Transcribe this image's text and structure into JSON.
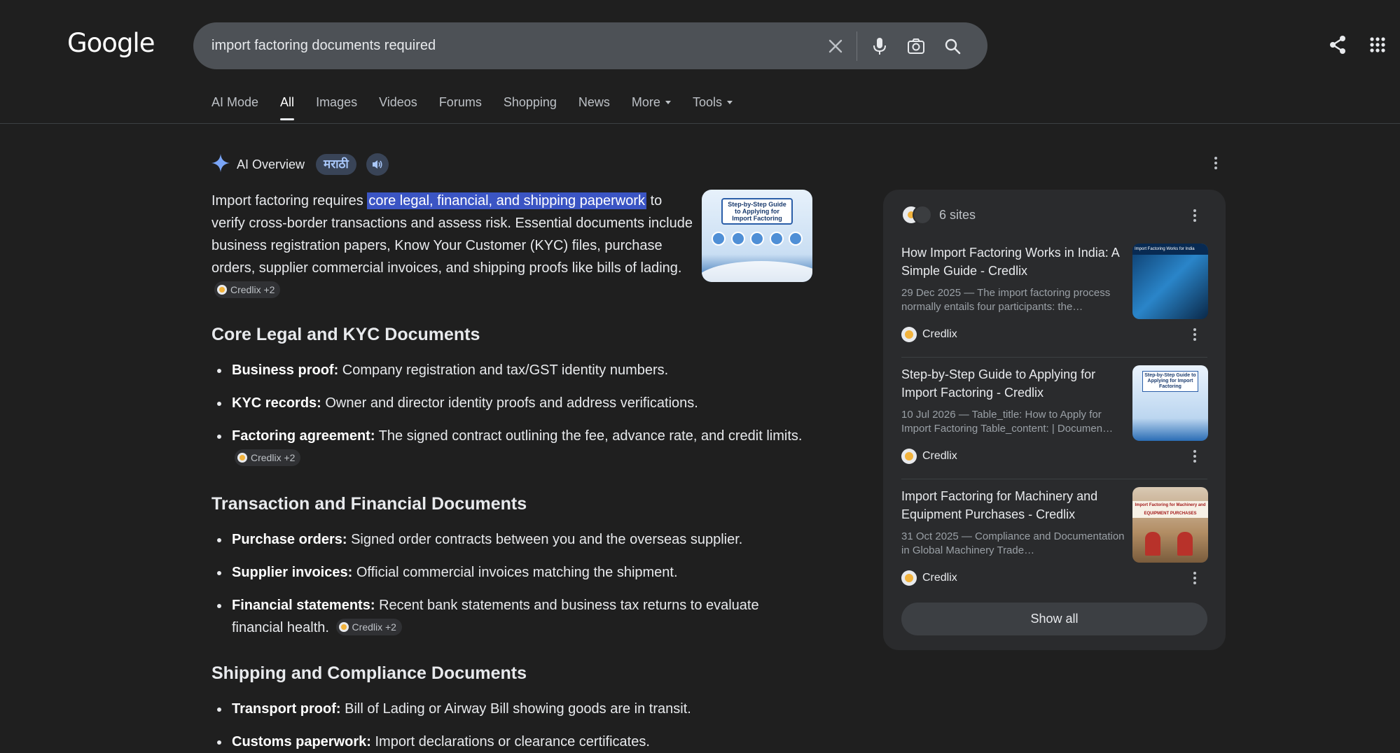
{
  "header": {
    "logo": "Google",
    "search": {
      "query": "import factoring documents required"
    }
  },
  "tabs": [
    {
      "label": "AI Mode"
    },
    {
      "label": "All"
    },
    {
      "label": "Images"
    },
    {
      "label": "Videos"
    },
    {
      "label": "Forums"
    },
    {
      "label": "Shopping"
    },
    {
      "label": "News"
    },
    {
      "label": "More"
    },
    {
      "label": "Tools"
    }
  ],
  "ai_overview": {
    "title": "AI Overview",
    "language_button": "मराठी",
    "intro": {
      "before": "Import factoring requires ",
      "highlight": "core legal, financial, and shipping paperwork",
      "after": " to verify cross-border transactions and assess risk. Essential documents include business registration papers, Know Your Customer (KYC) files, purchase orders, supplier commercial invoices, and shipping proofs like bills of lading.",
      "citation": "Credlix +2"
    },
    "thumbnail": {
      "title": "Step-by-Step Guide to Applying for Import Factoring"
    },
    "sections": [
      {
        "heading": "Core Legal and KYC Documents",
        "items": [
          {
            "term": "Business proof:",
            "text": " Company registration and tax/GST identity numbers."
          },
          {
            "term": "KYC records:",
            "text": " Owner and director identity proofs and address verifications."
          },
          {
            "term": "Factoring agreement:",
            "text": " The signed contract outlining the fee, advance rate, and credit limits.",
            "citation": "Credlix +2"
          }
        ]
      },
      {
        "heading": "Transaction and Financial Documents",
        "items": [
          {
            "term": "Purchase orders:",
            "text": " Signed order contracts between you and the overseas supplier."
          },
          {
            "term": "Supplier invoices:",
            "text": " Official commercial invoices matching the shipment."
          },
          {
            "term": "Financial statements:",
            "text": " Recent bank statements and business tax returns to evaluate financial health.",
            "citation": "Credlix +2"
          }
        ]
      },
      {
        "heading": "Shipping and Compliance Documents",
        "items": [
          {
            "term": "Transport proof:",
            "text": " Bill of Lading or Airway Bill showing goods are in transit."
          },
          {
            "term": "Customs paperwork:",
            "text": " Import declarations or clearance certificates."
          }
        ]
      }
    ]
  },
  "sources": {
    "count_label": "6 sites",
    "items": [
      {
        "title": "How Import Factoring Works in India: A Simple Guide - Credlix",
        "snippet": "29 Dec 2025 — The import factoring process normally entails four participants: the…",
        "site": "Credlix",
        "image_caption": "Import Factoring Works for India"
      },
      {
        "title": "Step-by-Step Guide to Applying for Import Factoring - Credlix",
        "snippet": "10 Jul 2026 — Table_title: How to Apply for Import Factoring Table_content: | Documen…",
        "site": "Credlix",
        "image_caption": "Step-by-Step Guide to Applying for Import Factoring"
      },
      {
        "title": "Import Factoring for Machinery and Equipment Purchases - Credlix",
        "snippet": "31 Oct 2025 — Compliance and Documentation in Global Machinery Trade…",
        "site": "Credlix",
        "image_caption": "Import Factoring for Machinery and EQUIPMENT PURCHASES"
      }
    ],
    "show_all": "Show all"
  }
}
